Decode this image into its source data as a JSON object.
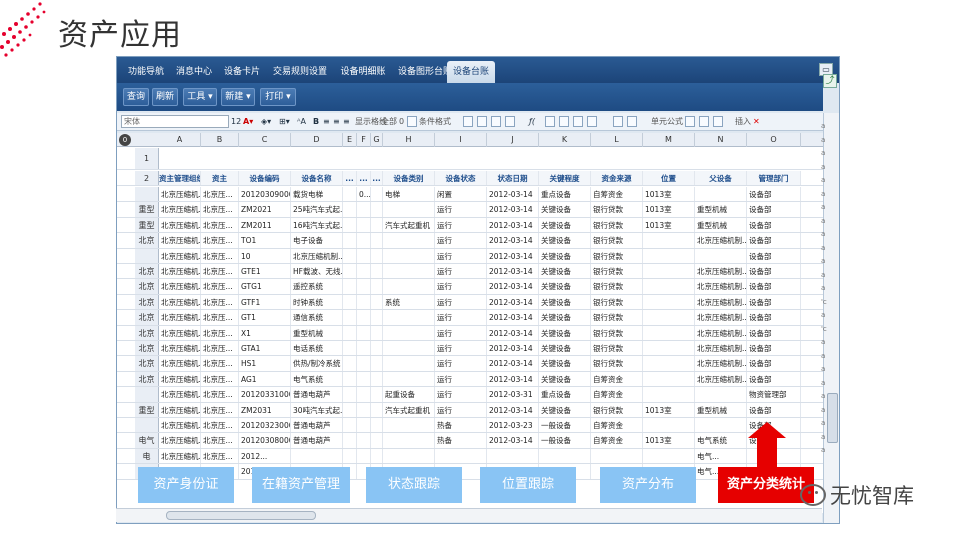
{
  "slide": {
    "title": "资产应用"
  },
  "nav": {
    "tabs": [
      "功能导航",
      "消息中心",
      "设备卡片",
      "交易规则设置",
      "设备明细账",
      "设备图形台账",
      "设备台账"
    ],
    "active_tab": "设备台账"
  },
  "toolbar": {
    "query": "查询",
    "refresh": "刷新",
    "tools": "工具",
    "new": "新建",
    "print": "打印"
  },
  "format_bar": {
    "font": "宋体",
    "size": "12",
    "show_grid": "显示格线",
    "all": "全部",
    "zero": "0",
    "cond_format": "条件格式",
    "cell_formula": "单元公式",
    "insert": "插入"
  },
  "sheet": {
    "corner": "0",
    "columns": [
      "A",
      "B",
      "C",
      "D",
      "E",
      "F",
      "G",
      "H",
      "I",
      "J",
      "K",
      "L",
      "M",
      "N",
      "O"
    ],
    "header_row_number": "2",
    "header": [
      "资主管理组织",
      "资主",
      "设备编码",
      "设备名称",
      "...",
      "...",
      "...",
      "设备类别",
      "设备状态",
      "状态日期",
      "关键程度",
      "资金来源",
      "位置",
      "父设备",
      "管理部门"
    ],
    "row1_number": "1",
    "rows": [
      {
        "n": "",
        "a": "北京压缩机...",
        "b": "北京压...",
        "c": "201203090001",
        "d": "载货电梯",
        "e": "",
        "f": "0...",
        "g": "",
        "h": "电梯",
        "i": "闲置",
        "j": "2012-03-14",
        "k": "重点设备",
        "l": "自筹资金",
        "m": "1013室",
        "o": "设备部"
      },
      {
        "n": "重型机械",
        "a": "北京压缩机...",
        "b": "北京压...",
        "c": "ZM2021",
        "d": "25吨汽车式起...",
        "e": "",
        "f": "",
        "g": "",
        "h": "",
        "i": "运行",
        "j": "2012-03-14",
        "k": "关键设备",
        "l": "银行贷款",
        "m": "1013室",
        "o": "设备部"
      },
      {
        "n": "重型机械",
        "a": "北京压缩机...",
        "b": "北京压...",
        "c": "ZM2011",
        "d": "16吨汽车式起...",
        "e": "",
        "f": "",
        "g": "",
        "h": "汽车式起重机",
        "i": "运行",
        "j": "2012-03-14",
        "k": "关键设备",
        "l": "银行贷款",
        "m": "1013室",
        "o": "设备部"
      },
      {
        "n": "北京压缩机制...",
        "a": "北京压缩机...",
        "b": "北京压...",
        "c": "TO1",
        "d": "电子设备",
        "e": "",
        "f": "",
        "g": "",
        "h": "",
        "i": "运行",
        "j": "2012-03-14",
        "k": "关键设备",
        "l": "银行贷款",
        "m": "",
        "o": "设备部"
      },
      {
        "n": "",
        "a": "北京压缩机...",
        "b": "北京压...",
        "c": "10",
        "d": "北京压缩机制...",
        "e": "",
        "f": "",
        "g": "",
        "h": "",
        "i": "运行",
        "j": "2012-03-14",
        "k": "关键设备",
        "l": "银行贷款",
        "m": "",
        "o": "设备部"
      },
      {
        "n": "北京压缩机制...",
        "a": "北京压缩机...",
        "b": "北京压...",
        "c": "GTE1",
        "d": "HF载波、无线...",
        "e": "",
        "f": "",
        "g": "",
        "h": "",
        "i": "运行",
        "j": "2012-03-14",
        "k": "关键设备",
        "l": "银行贷款",
        "m": "",
        "o": "设备部"
      },
      {
        "n": "北京压缩机制...",
        "a": "北京压缩机...",
        "b": "北京压...",
        "c": "GTG1",
        "d": "遥控系统",
        "e": "",
        "f": "",
        "g": "",
        "h": "",
        "i": "运行",
        "j": "2012-03-14",
        "k": "关键设备",
        "l": "银行贷款",
        "m": "",
        "o": "设备部"
      },
      {
        "n": "北京压缩机制...",
        "a": "北京压缩机...",
        "b": "北京压...",
        "c": "GTF1",
        "d": "时钟系统",
        "e": "",
        "f": "",
        "g": "",
        "h": "系统",
        "i": "运行",
        "j": "2012-03-14",
        "k": "关键设备",
        "l": "银行贷款",
        "m": "",
        "o": "设备部"
      },
      {
        "n": "北京压缩机制...",
        "a": "北京压缩机...",
        "b": "北京压...",
        "c": "GT1",
        "d": "通信系统",
        "e": "",
        "f": "",
        "g": "",
        "h": "",
        "i": "运行",
        "j": "2012-03-14",
        "k": "关键设备",
        "l": "银行贷款",
        "m": "",
        "o": "设备部"
      },
      {
        "n": "北京压缩机制...",
        "a": "北京压缩机...",
        "b": "北京压...",
        "c": "X1",
        "d": "重型机械",
        "e": "",
        "f": "",
        "g": "",
        "h": "",
        "i": "运行",
        "j": "2012-03-14",
        "k": "关键设备",
        "l": "银行贷款",
        "m": "",
        "o": "设备部"
      },
      {
        "n": "北京压缩机制...",
        "a": "北京压缩机...",
        "b": "北京压...",
        "c": "GTA1",
        "d": "电话系统",
        "e": "",
        "f": "",
        "g": "",
        "h": "",
        "i": "运行",
        "j": "2012-03-14",
        "k": "关键设备",
        "l": "银行贷款",
        "m": "",
        "o": "设备部"
      },
      {
        "n": "北京压缩机制...",
        "a": "北京压缩机...",
        "b": "北京压...",
        "c": "HS1",
        "d": "供热/制冷系统",
        "e": "",
        "f": "",
        "g": "",
        "h": "",
        "i": "运行",
        "j": "2012-03-14",
        "k": "关键设备",
        "l": "银行贷款",
        "m": "",
        "o": "设备部"
      },
      {
        "n": "北京压缩机制...",
        "a": "北京压缩机...",
        "b": "北京压...",
        "c": "AG1",
        "d": "电气系统",
        "e": "",
        "f": "",
        "g": "",
        "h": "",
        "i": "运行",
        "j": "2012-03-14",
        "k": "关键设备",
        "l": "自筹资金",
        "m": "",
        "o": "设备部"
      },
      {
        "n": "",
        "a": "北京压缩机...",
        "b": "北京压...",
        "c": "201203310001",
        "d": "普通电葫芦",
        "e": "",
        "f": "",
        "g": "",
        "h": "起重设备",
        "i": "运行",
        "j": "2012-03-31",
        "k": "重点设备",
        "l": "自筹资金",
        "m": "",
        "o": "物资管理部"
      },
      {
        "n": "重型机械",
        "a": "北京压缩机...",
        "b": "北京压...",
        "c": "ZM2031",
        "d": "30吨汽车式起...",
        "e": "",
        "f": "",
        "g": "",
        "h": "汽车式起重机",
        "i": "运行",
        "j": "2012-03-14",
        "k": "关键设备",
        "l": "银行贷款",
        "m": "1013室",
        "o": "设备部"
      },
      {
        "n": "",
        "a": "北京压缩机...",
        "b": "北京压...",
        "c": "201203230002",
        "d": "普通电葫芦",
        "e": "",
        "f": "",
        "g": "",
        "h": "",
        "i": "热备",
        "j": "2012-03-23",
        "k": "一般设备",
        "l": "自筹资金",
        "m": "",
        "o": "设备部"
      },
      {
        "n": "电气系统",
        "a": "北京压缩机...",
        "b": "北京压...",
        "c": "201203080002",
        "d": "普通电葫芦",
        "e": "",
        "f": "",
        "g": "",
        "h": "",
        "i": "热备",
        "j": "2012-03-14",
        "k": "一般设备",
        "l": "自筹资金",
        "m": "1013室",
        "o": "设备部"
      },
      {
        "n": "电气...",
        "a": "北京压缩机...",
        "b": "北京压...",
        "c": "2012...",
        "d": "",
        "e": "",
        "f": "",
        "g": "",
        "h": "",
        "i": "",
        "j": "",
        "k": "",
        "l": "",
        "m": "",
        "o": ""
      },
      {
        "n": "电气...",
        "a": "北京压缩机...",
        "b": "北京压...",
        "c": "2012...",
        "d": "",
        "e": "",
        "f": "",
        "g": "",
        "h": "",
        "i": "",
        "j": "",
        "k": "",
        "l": "",
        "m": "",
        "o": ""
      }
    ]
  },
  "overlay": {
    "buttons": [
      "资产身份证",
      "在籍资产管理",
      "状态跟踪",
      "位置跟踪",
      "资产分布"
    ],
    "highlight": "资产分类统计"
  },
  "brand": {
    "name": "无忧智库"
  },
  "side": {
    "letters": "a a a a a a a a a a a a a 'c a 'c a a a a a a a a a"
  }
}
